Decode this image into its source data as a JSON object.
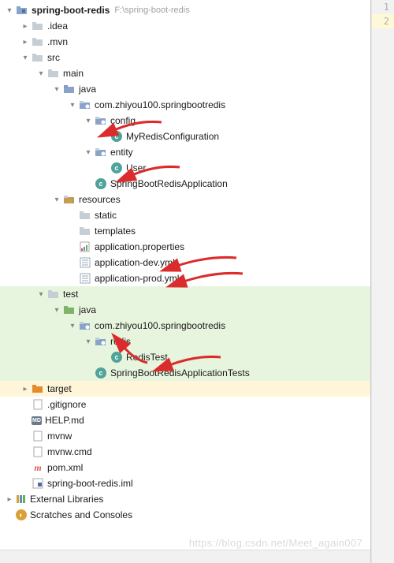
{
  "project": {
    "name": "spring-boot-redis",
    "path": "F:\\spring-boot-redis"
  },
  "tree": {
    "idea": ".idea",
    "mvn": ".mvn",
    "src": "src",
    "main": "main",
    "java_main": "java",
    "pkg_main": "com.zhiyou100.springbootredis",
    "config": "config",
    "myRedisConfig": "MyRedisConfiguration",
    "entity": "entity",
    "user": "User",
    "springBootApp": "SpringBootRedisApplication",
    "resources": "resources",
    "static": "static",
    "templates": "templates",
    "appProps": "application.properties",
    "appDev": "application-dev.yml",
    "appProd": "application-prod.yml",
    "test": "test",
    "java_test": "java",
    "pkg_test": "com.zhiyou100.springbootredis",
    "redis": "redis",
    "redisTest": "RedisTest",
    "springBootTests": "SpringBootRedisApplicationTests",
    "target": "target",
    "gitignore": ".gitignore",
    "help": "HELP.md",
    "mvnw": "mvnw",
    "mvnwcmd": "mvnw.cmd",
    "pom": "pom.xml",
    "iml": "spring-boot-redis.iml",
    "externalLibs": "External Libraries",
    "scratches": "Scratches and Consoles"
  },
  "gutter": {
    "line1": "1",
    "line2": "2"
  },
  "watermark": "https://blog.csdn.net/Meet_again007"
}
